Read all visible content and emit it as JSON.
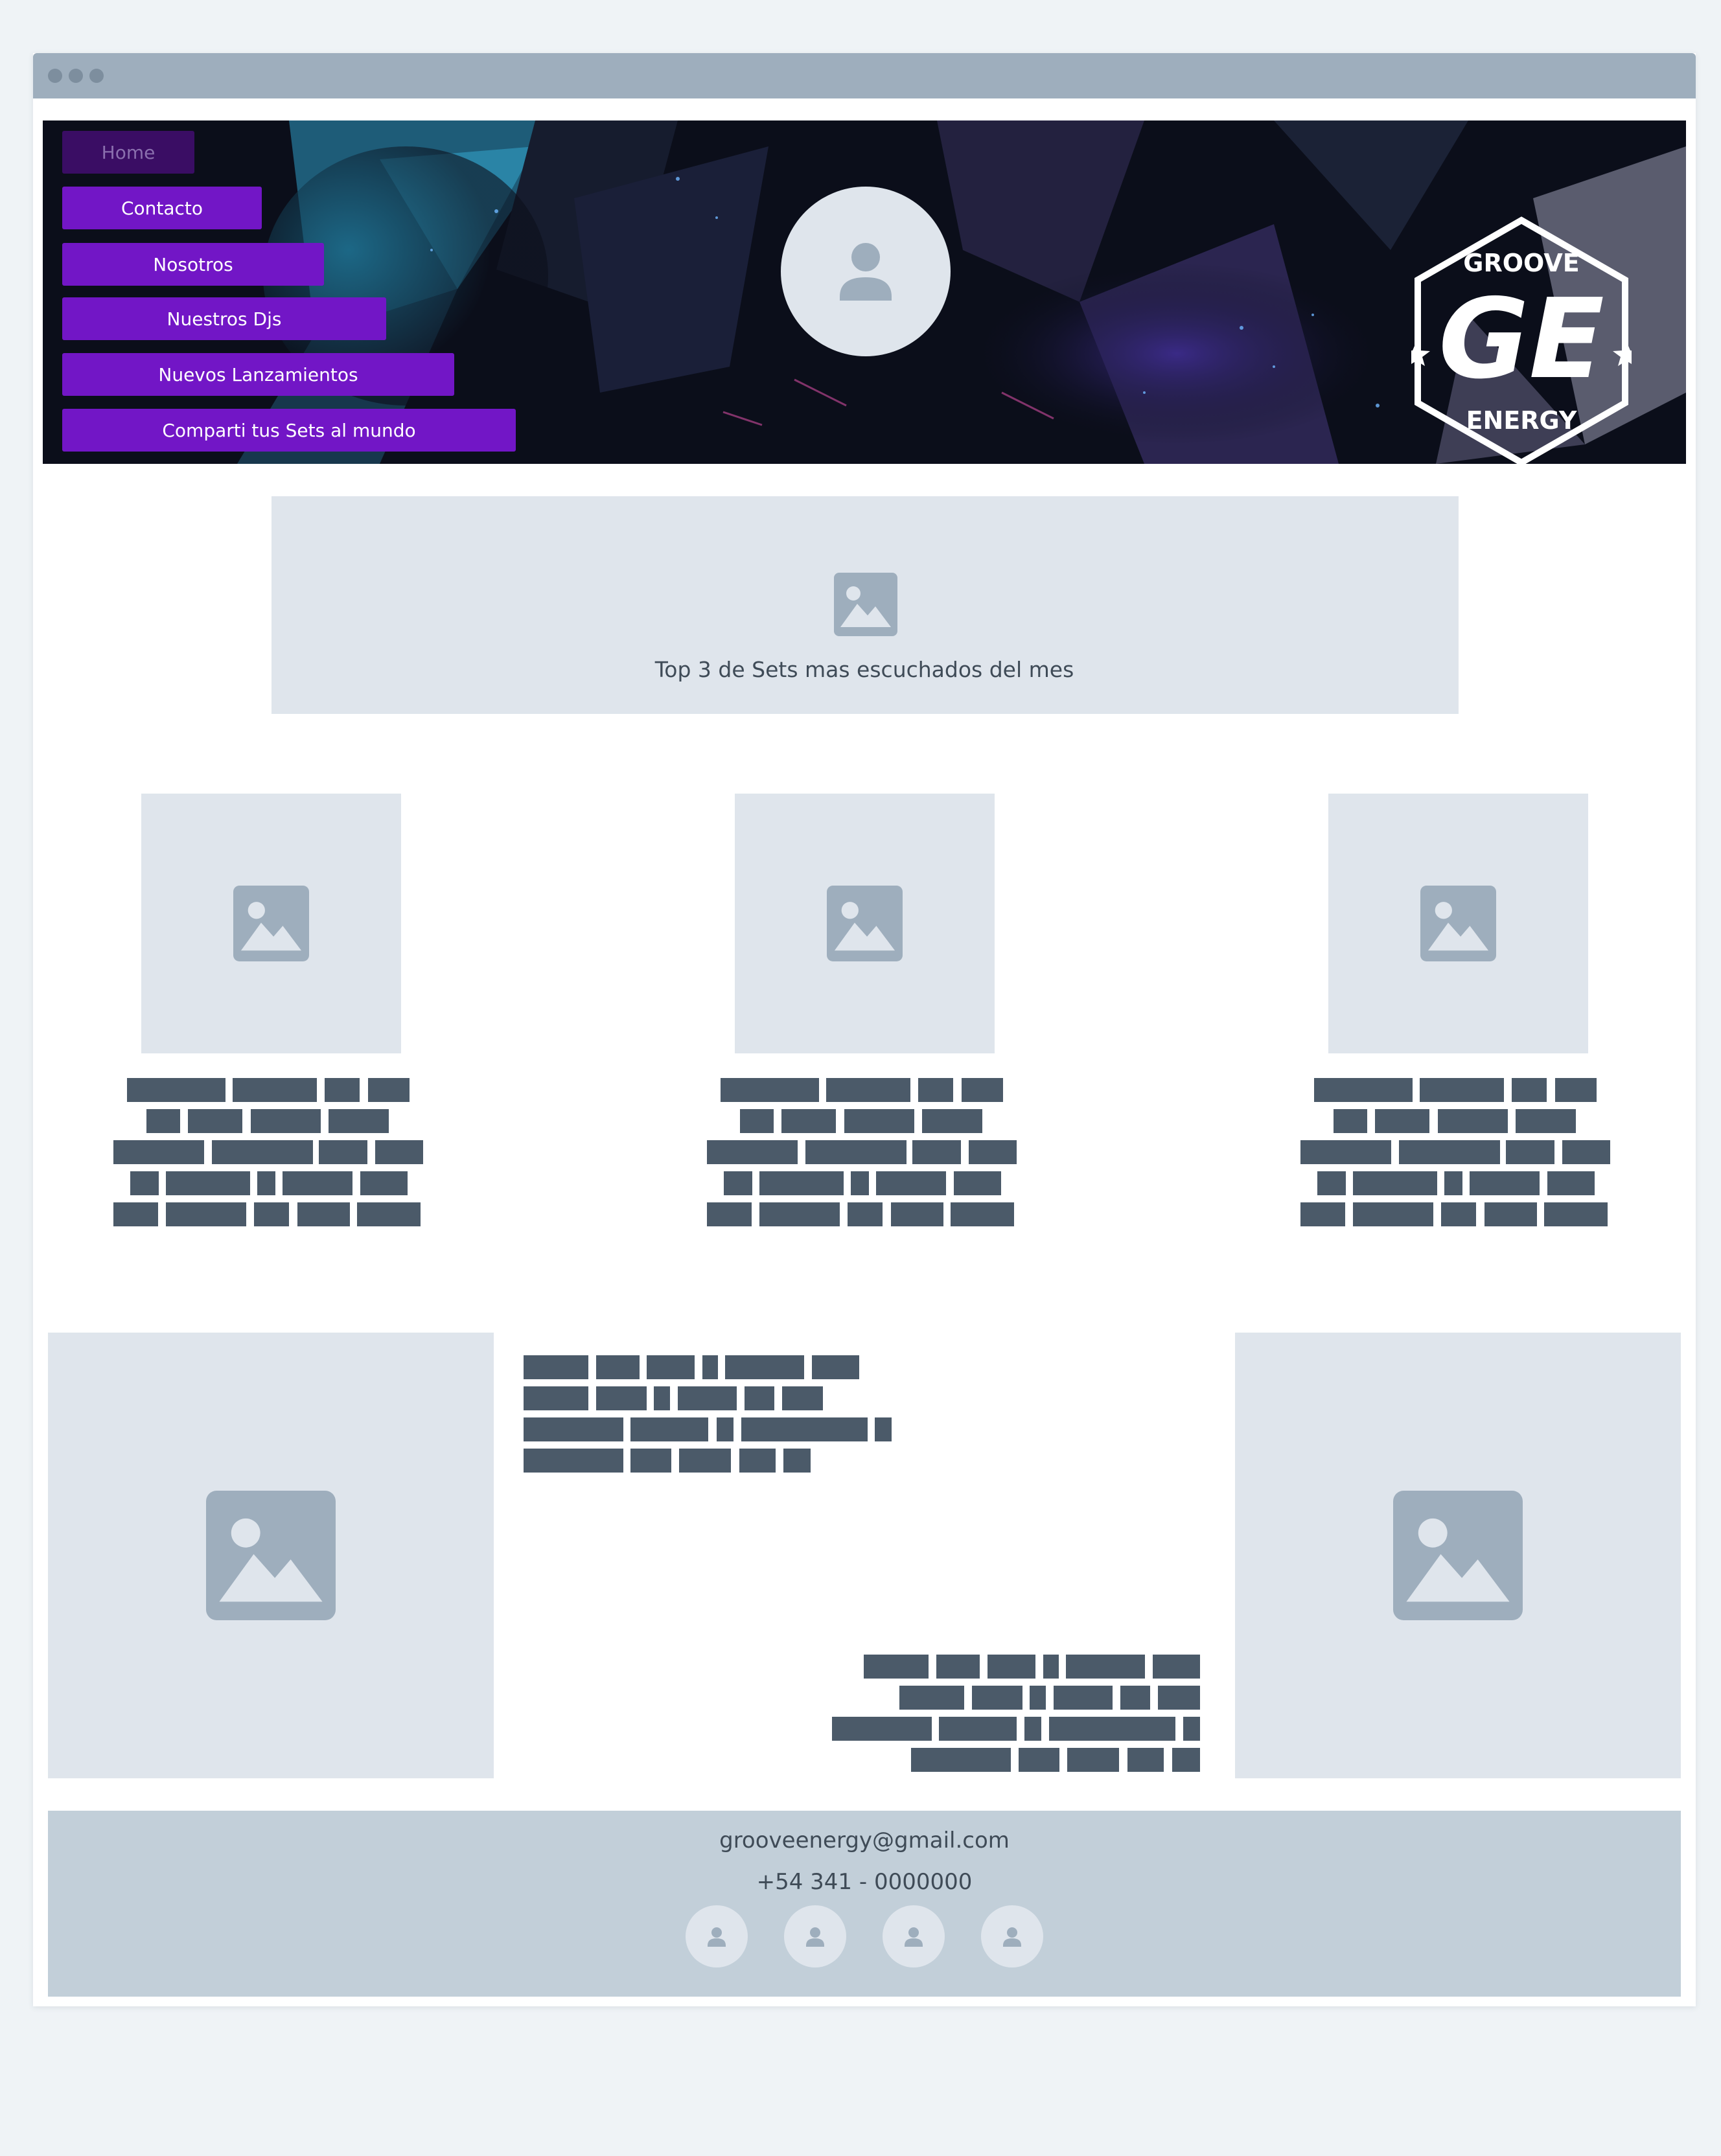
{
  "nav": {
    "items": [
      {
        "label": "Home",
        "active": true
      },
      {
        "label": "Contacto"
      },
      {
        "label": "Nosotros"
      },
      {
        "label": "Nuestros Djs"
      },
      {
        "label": "Nuevos Lanzamientos"
      },
      {
        "label": "Comparti tus Sets al mundo"
      }
    ]
  },
  "logo": {
    "top_text": "GROOVE",
    "monogram": "GE",
    "bottom_text": "ENERGY"
  },
  "banner": {
    "caption": "Top 3 de Sets mas escuchados del mes"
  },
  "footer": {
    "email": "grooveenergy@gmail.com",
    "phone": "+54 341 - 0000000"
  },
  "colors": {
    "nav_button": "#7216c6",
    "placeholder": "#dfe5ec",
    "placeholder_icon": "#9eaebd",
    "text_block": "#4b5a69",
    "footer_bg": "#c2cfd9",
    "window_bar": "#9eaebd"
  },
  "icons": {
    "avatar": "user-icon",
    "image_placeholder": "image-icon",
    "social": "user-icon"
  }
}
